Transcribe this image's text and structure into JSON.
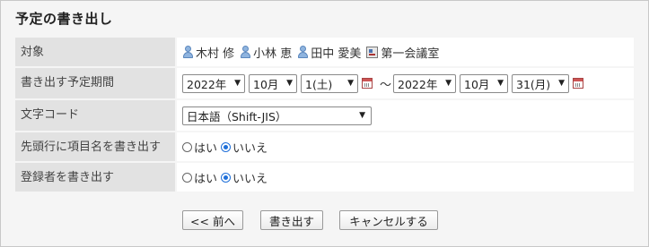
{
  "title": "予定の書き出し",
  "fields": {
    "target": {
      "label": "対象",
      "users": [
        "木村 修",
        "小林 恵",
        "田中 愛美"
      ],
      "facility": "第一会議室"
    },
    "period": {
      "label": "書き出す予定期間",
      "start": {
        "year": "2022年",
        "month": "10月",
        "day": "1(土)"
      },
      "separator": "〜",
      "end": {
        "year": "2022年",
        "month": "10月",
        "day": "31(月)"
      }
    },
    "encoding": {
      "label": "文字コード",
      "selected": "日本語（Shift-JIS）"
    },
    "header_row": {
      "label": "先頭行に項目名を書き出す",
      "options": [
        "はい",
        "いいえ"
      ],
      "selected": "いいえ"
    },
    "registrant": {
      "label": "登録者を書き出す",
      "options": [
        "はい",
        "いいえ"
      ],
      "selected": "いいえ"
    }
  },
  "buttons": {
    "back": "<< 前へ",
    "export": "書き出す",
    "cancel": "キャンセルする"
  },
  "icons": {
    "user": "user-icon",
    "facility": "facility-icon",
    "calendar": "calendar-icon"
  },
  "colors": {
    "label_bg": "#e2e2e2",
    "panel_bg": "#f5f5f5",
    "radio_accent": "#1e6fd9"
  }
}
